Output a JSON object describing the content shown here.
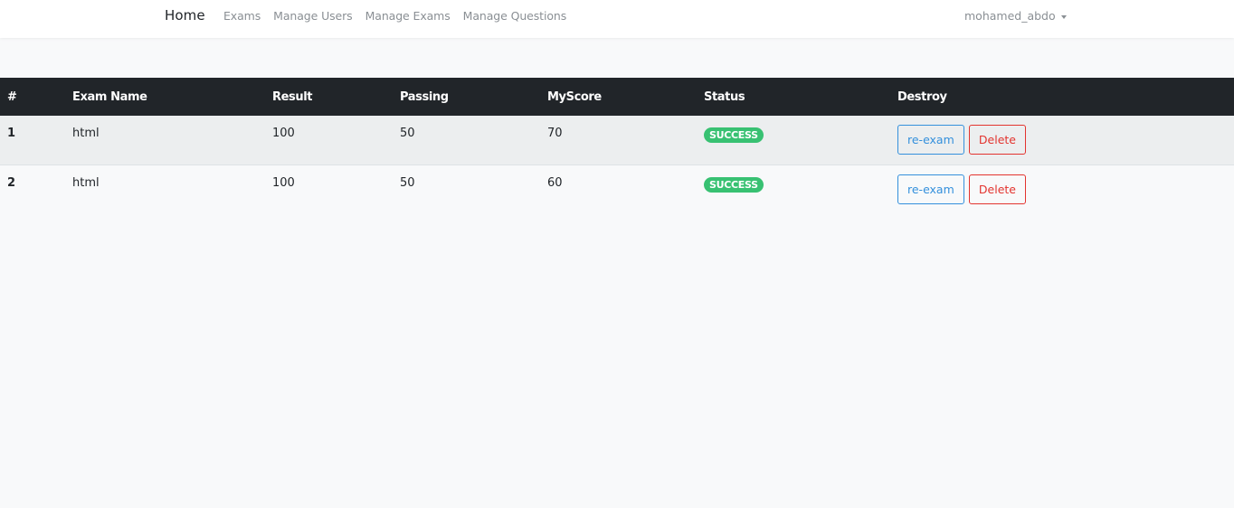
{
  "navbar": {
    "brand": "Home",
    "links": [
      "Exams",
      "Manage Users",
      "Manage Exams",
      "Manage Questions"
    ],
    "user": "mohamed_abdo"
  },
  "table": {
    "headers": [
      "#",
      "Exam Name",
      "Result",
      "Passing",
      "MyScore",
      "Status",
      "Destroy"
    ],
    "rows": [
      {
        "index": "1",
        "exam": "html",
        "result": "100",
        "passing": "50",
        "score": "70",
        "status": "SUCCESS",
        "reexam_label": "re-exam",
        "delete_label": "Delete"
      },
      {
        "index": "2",
        "exam": "html",
        "result": "100",
        "passing": "50",
        "score": "60",
        "status": "SUCCESS",
        "reexam_label": "re-exam",
        "delete_label": "Delete"
      }
    ]
  },
  "colors": {
    "header_bg": "#212529",
    "success": "#38c172",
    "primary": "#3490dc",
    "danger": "#e3342f"
  },
  "icons": {
    "user_dropdown": "caret-down-icon"
  }
}
